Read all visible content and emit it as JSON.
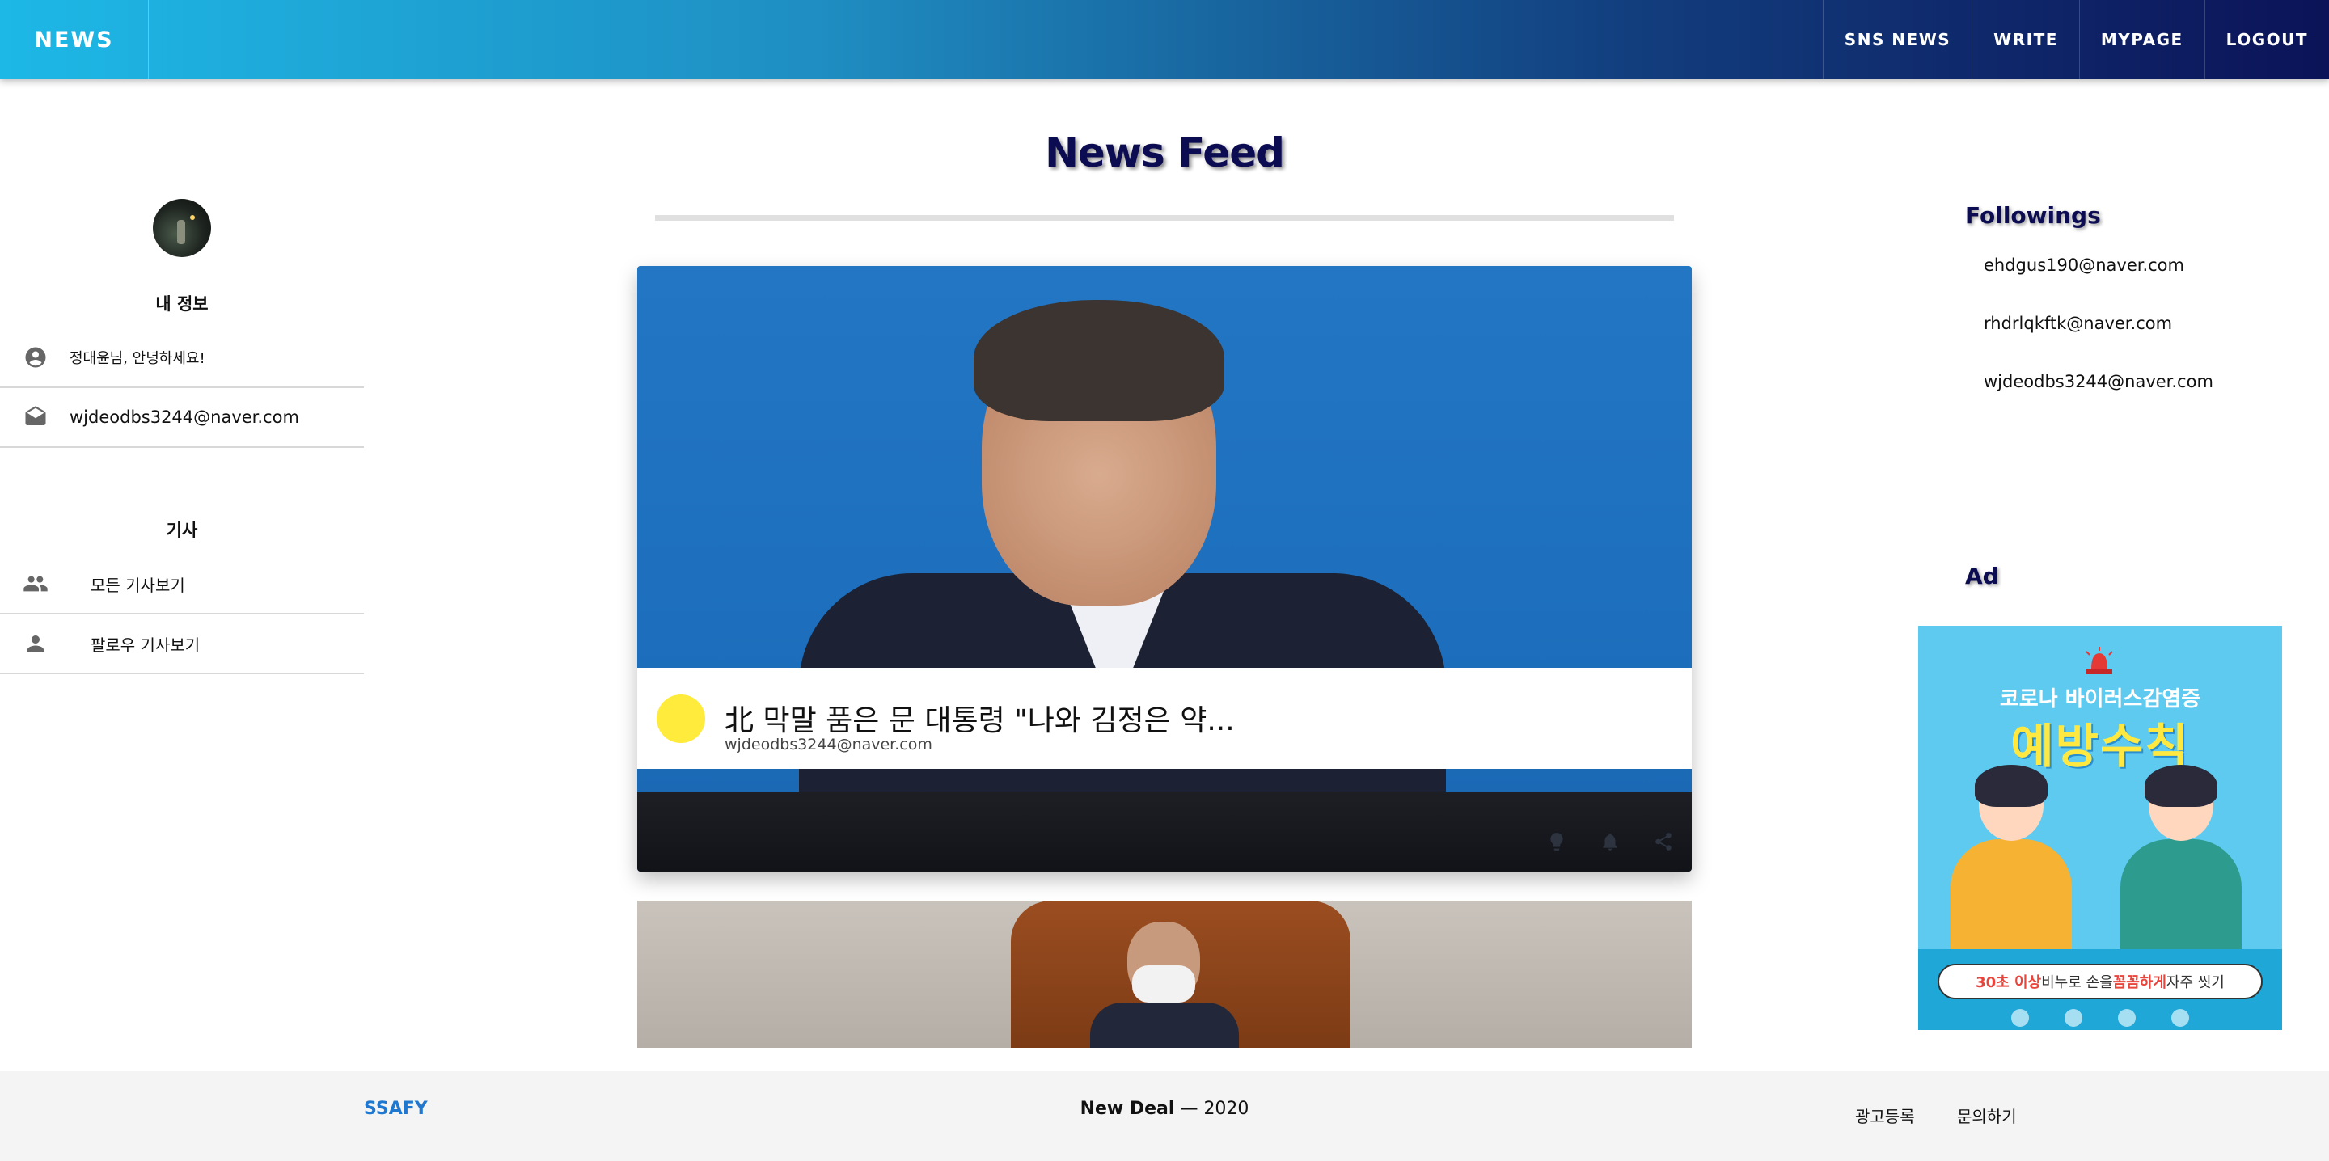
{
  "header": {
    "brand": "NEWS",
    "nav": [
      "SNS NEWS",
      "WRITE",
      "MYPAGE",
      "LOGOUT"
    ]
  },
  "main": {
    "title": "News Feed",
    "cards": [
      {
        "title": "北 막말 품은 문 대통령 \"나와 김정은 약...",
        "author": "wjdeodbs3244@naver.com"
      }
    ]
  },
  "sidebar": {
    "profile_heading": "내 정보",
    "greeting": "정대윤님, 안녕하세요!",
    "email": "wjdeodbs3244@naver.com",
    "articles_heading": "기사",
    "items": [
      "모든 기사보기",
      "팔로우 기사보기"
    ]
  },
  "right": {
    "followings_heading": "Followings",
    "followings": [
      "ehdgus190@naver.com",
      "rhdrlqkftk@naver.com",
      "wjdeodbs3244@naver.com"
    ],
    "ad_heading": "Ad"
  },
  "ad": {
    "line1": "코로나 바이러스감염증",
    "line2": "예방수칙",
    "banner_a": "30초 이상",
    "banner_b": " 비누로 손을 ",
    "banner_c": "꼼꼼하게",
    "banner_d": " 자주 씻기"
  },
  "footer": {
    "brand": "SSAFY",
    "center_bold": "New Deal",
    "center_rest": " — 2020",
    "links": [
      "광고등록",
      "문의하기"
    ]
  },
  "colors": {
    "header_start": "#1db8e6",
    "header_end": "#0c1358",
    "title": "#0c0c52",
    "footer_brand": "#1f77d0",
    "avatar_dot": "#ffeb3b"
  },
  "icons": [
    "account-circle-icon",
    "mail-open-icon",
    "people-icon",
    "person-icon",
    "lightbulb-icon",
    "bell-icon",
    "share-icon"
  ]
}
